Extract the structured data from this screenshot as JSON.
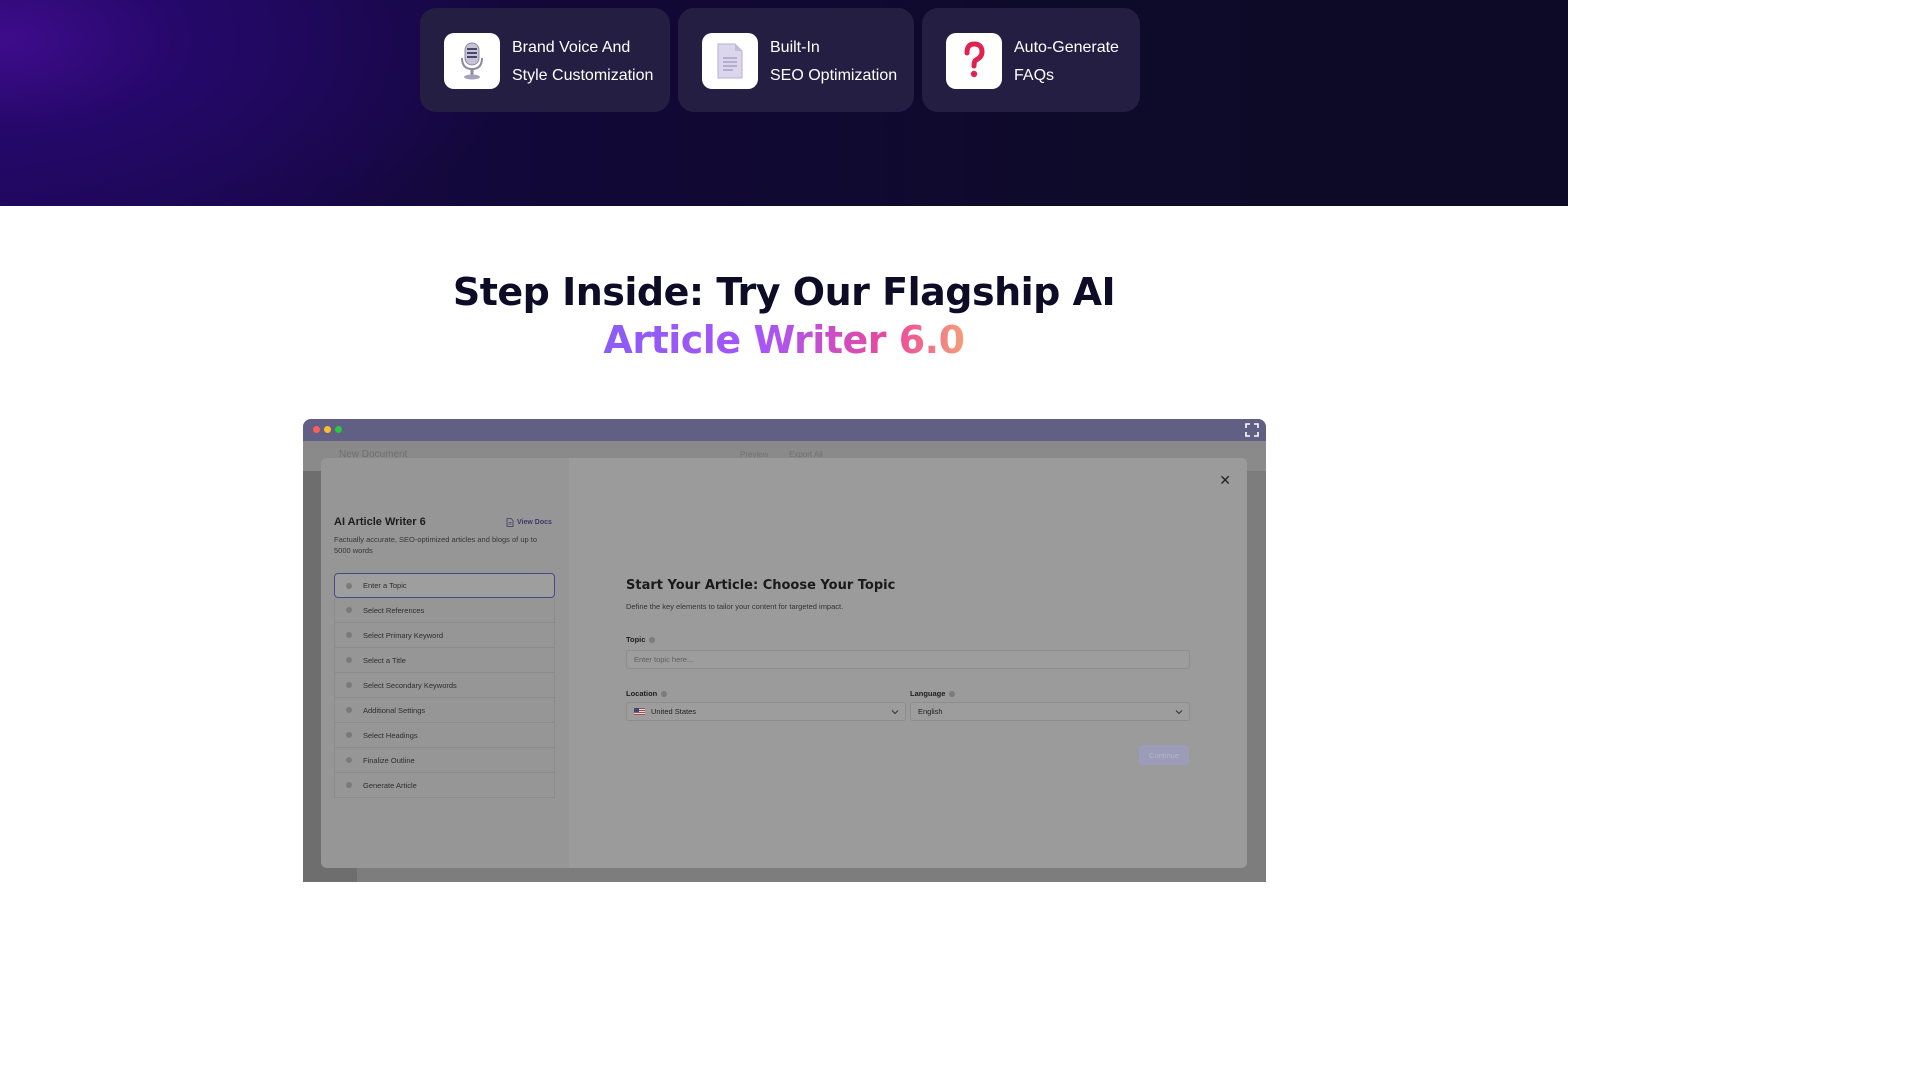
{
  "features": [
    {
      "icon": "microphone-icon",
      "line1": "Brand Voice And",
      "line2": "Style Customization"
    },
    {
      "icon": "document-icon",
      "line1": "Built-In",
      "line2": "SEO Optimization"
    },
    {
      "icon": "question-mark-icon",
      "line1": "Auto-Generate",
      "line2": "FAQs"
    }
  ],
  "heading": {
    "line1": "Step Inside: Try Our Flagship AI",
    "line2": "Article Writer 6.0"
  },
  "app": {
    "doc_title": "New Document",
    "topbar_items": [
      "Preview",
      "Export All"
    ],
    "name": "AI Article Writer 6",
    "view_docs": "View Docs",
    "description": "Factually accurate, SEO-optimized articles and blogs of up to 5000 words",
    "steps": [
      "Enter a Topic",
      "Select References",
      "Select Primary Keyword",
      "Select a Title",
      "Select Secondary Keywords",
      "Additional Settings",
      "Select Headings",
      "Finalize Outline",
      "Generate Article"
    ],
    "form": {
      "title": "Start Your Article: Choose Your Topic",
      "subtitle": "Define the key elements to tailor your content for targeted impact.",
      "topic_label": "Topic",
      "topic_placeholder": "Enter topic here...",
      "location_label": "Location",
      "location_value": "United States",
      "language_label": "Language",
      "language_value": "English",
      "continue_label": "Continue"
    }
  },
  "colors": {
    "hero_bg": "#0e0a2a",
    "card_bg": "#241f42",
    "heading": "#0d0b26",
    "gradient_start": "#8b5cf6",
    "gradient_end": "#f59e7a"
  }
}
